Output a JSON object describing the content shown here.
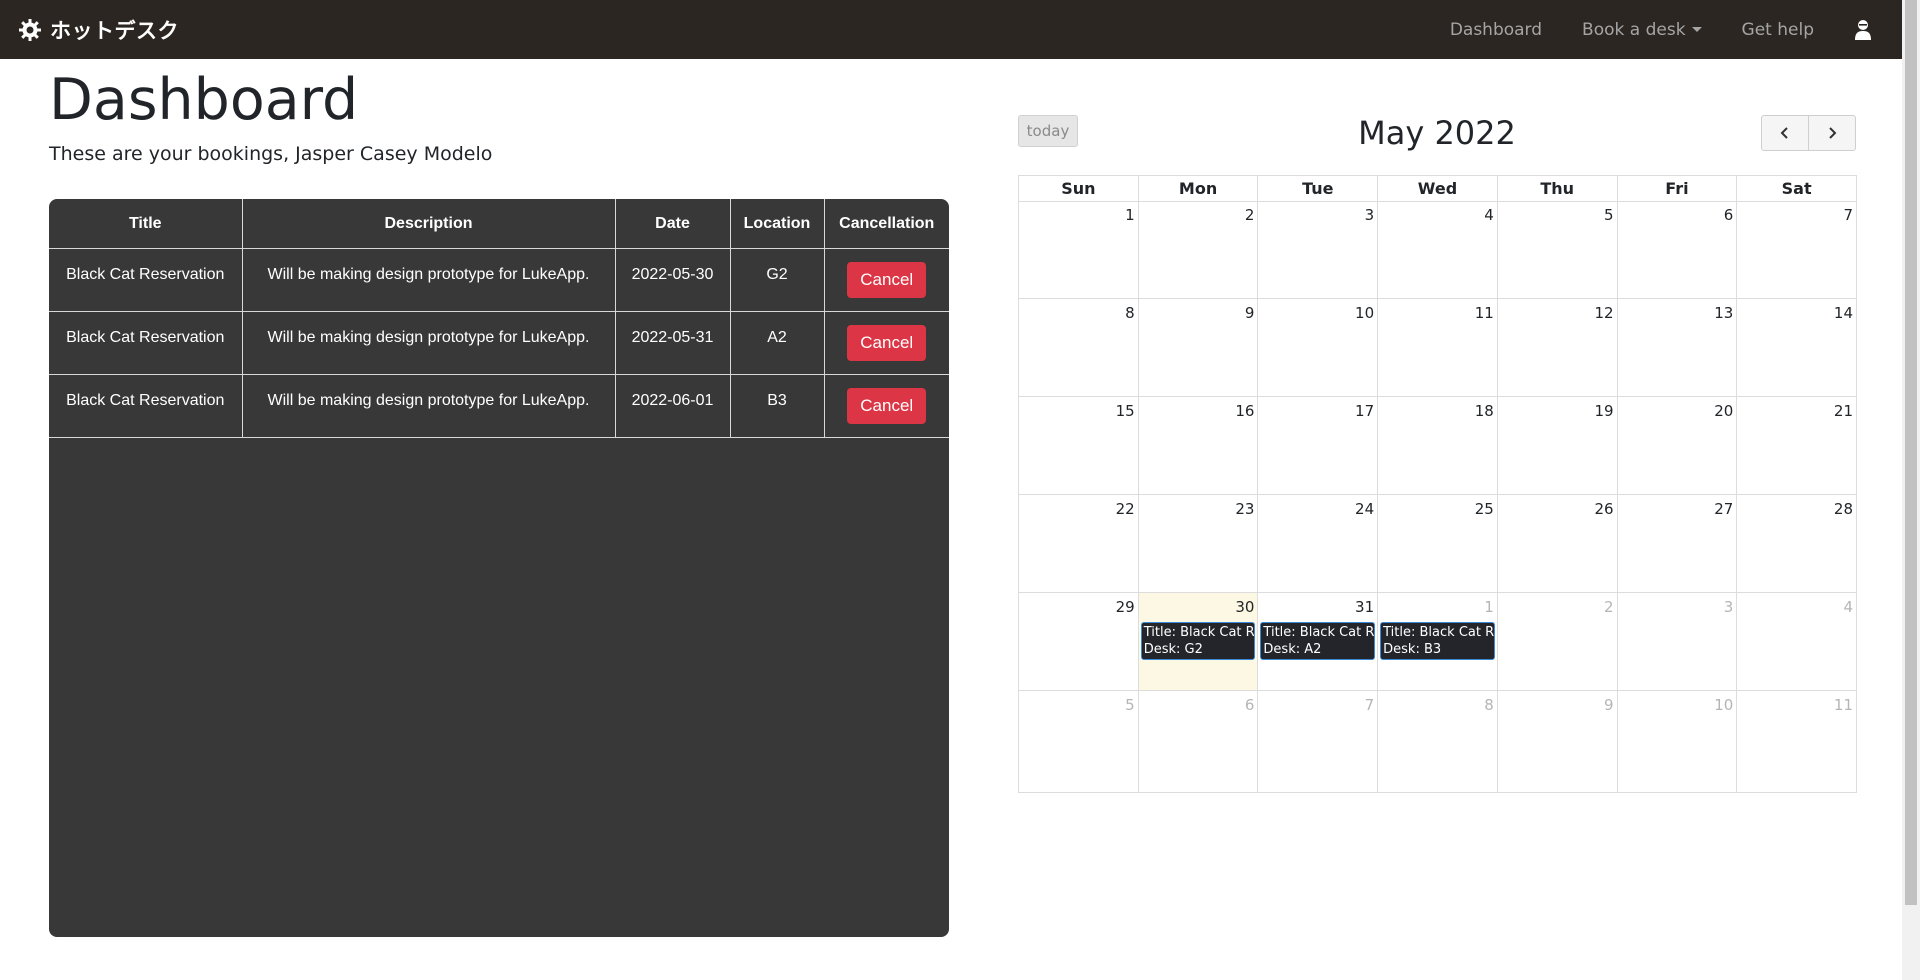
{
  "navbar": {
    "brand": "ホットデスク",
    "links": [
      {
        "label": "Dashboard"
      },
      {
        "label": "Book a desk"
      },
      {
        "label": "Get help"
      }
    ]
  },
  "page": {
    "title": "Dashboard",
    "subtitle": "These are your bookings, Jasper Casey Modelo"
  },
  "bookings": {
    "headers": [
      "Title",
      "Description",
      "Date",
      "Location",
      "Cancellation"
    ],
    "rows": [
      {
        "title": "Black Cat Reservation",
        "description": "Will be making design prototype for LukeApp.",
        "date": "2022-05-30",
        "location": "G2",
        "action": "Cancel"
      },
      {
        "title": "Black Cat Reservation",
        "description": "Will be making design prototype for LukeApp.",
        "date": "2022-05-31",
        "location": "A2",
        "action": "Cancel"
      },
      {
        "title": "Black Cat Reservation",
        "description": "Will be making design prototype for LukeApp.",
        "date": "2022-06-01",
        "location": "B3",
        "action": "Cancel"
      }
    ]
  },
  "calendar": {
    "today_label": "today",
    "title": "May 2022",
    "prev_icon": "chevron-left-icon",
    "next_icon": "chevron-right-icon",
    "weekdays": [
      "Sun",
      "Mon",
      "Tue",
      "Wed",
      "Thu",
      "Fri",
      "Sat"
    ],
    "weeks": [
      [
        {
          "d": "1"
        },
        {
          "d": "2"
        },
        {
          "d": "3"
        },
        {
          "d": "4"
        },
        {
          "d": "5"
        },
        {
          "d": "6"
        },
        {
          "d": "7"
        }
      ],
      [
        {
          "d": "8"
        },
        {
          "d": "9"
        },
        {
          "d": "10"
        },
        {
          "d": "11"
        },
        {
          "d": "12"
        },
        {
          "d": "13"
        },
        {
          "d": "14"
        }
      ],
      [
        {
          "d": "15"
        },
        {
          "d": "16"
        },
        {
          "d": "17"
        },
        {
          "d": "18"
        },
        {
          "d": "19"
        },
        {
          "d": "20"
        },
        {
          "d": "21"
        }
      ],
      [
        {
          "d": "22"
        },
        {
          "d": "23"
        },
        {
          "d": "24"
        },
        {
          "d": "25"
        },
        {
          "d": "26"
        },
        {
          "d": "27"
        },
        {
          "d": "28"
        }
      ],
      [
        {
          "d": "29"
        },
        {
          "d": "30",
          "today": true,
          "event": {
            "line1": "Title: Black Cat Reservation",
            "line2": "Desk: G2"
          }
        },
        {
          "d": "31",
          "event": {
            "line1": "Title: Black Cat Reservation",
            "line2": "Desk: A2"
          }
        },
        {
          "d": "1",
          "other": true,
          "event": {
            "line1": "Title: Black Cat Reservation",
            "line2": "Desk: B3"
          }
        },
        {
          "d": "2",
          "other": true
        },
        {
          "d": "3",
          "other": true
        },
        {
          "d": "4",
          "other": true
        }
      ],
      [
        {
          "d": "5",
          "other": true
        },
        {
          "d": "6",
          "other": true
        },
        {
          "d": "7",
          "other": true
        },
        {
          "d": "8",
          "other": true
        },
        {
          "d": "9",
          "other": true
        },
        {
          "d": "10",
          "other": true
        },
        {
          "d": "11",
          "other": true
        }
      ]
    ]
  },
  "colors": {
    "navbar_bg": "#2b2622",
    "table_bg": "#383838",
    "cancel_btn": "#dc3545",
    "today_cell": "#fcf8e3",
    "event_bg": "#23252a"
  }
}
